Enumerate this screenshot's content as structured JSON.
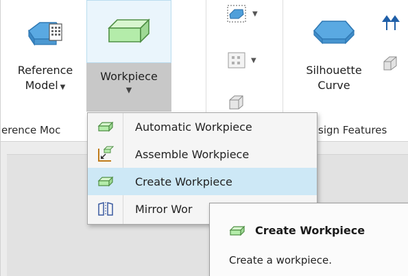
{
  "ribbon": {
    "buttons": {
      "reference_model": {
        "line1": "Reference",
        "line2": "Model"
      },
      "workpiece": {
        "label": "Workpiece"
      },
      "silhouette_curve": {
        "line1": "Silhouette",
        "line2": "Curve"
      }
    },
    "groups": {
      "reference_model_group": "erence Moc",
      "design_features_group": "sign Features"
    }
  },
  "menu": {
    "items": [
      {
        "label": "Automatic Workpiece",
        "icon": "workpiece-box-icon"
      },
      {
        "label": "Assemble Workpiece",
        "icon": "assemble-workpiece-icon"
      },
      {
        "label": "Create Workpiece",
        "icon": "workpiece-box-icon",
        "highlighted": true
      },
      {
        "label": "Mirror Wor",
        "icon": "mirror-workpiece-icon"
      }
    ]
  },
  "tooltip": {
    "title": "Create Workpiece",
    "description": "Create a workpiece."
  },
  "colors": {
    "highlight": "#cde8f6",
    "workpiece_green": "#b9ecb0",
    "reference_blue": "#6fb6e8",
    "pressed_gray": "#c8c8c8"
  }
}
